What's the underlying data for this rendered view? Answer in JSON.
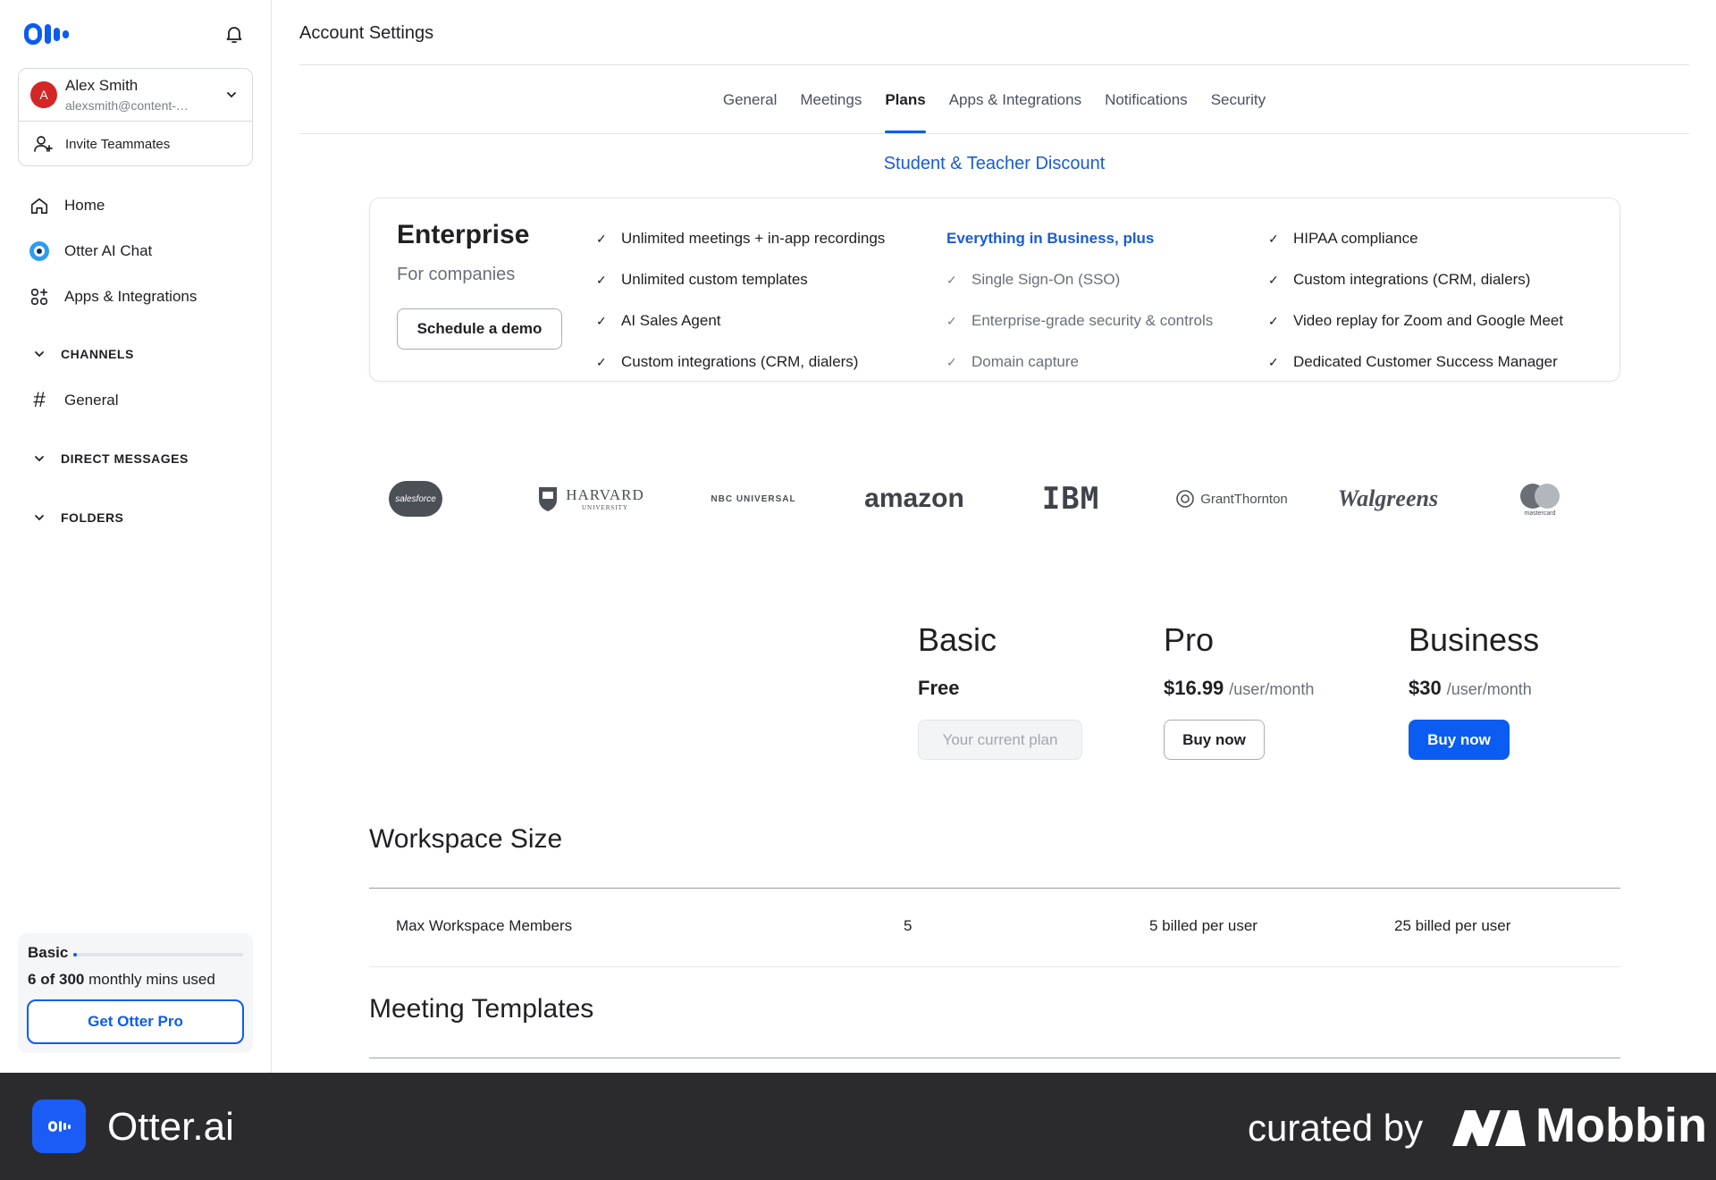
{
  "sidebar": {
    "user": {
      "initial": "A",
      "name": "Alex Smith",
      "email": "alexsmith@content-…"
    },
    "invite_label": "Invite Teammates",
    "nav": [
      {
        "label": "Home",
        "icon": "home-icon"
      },
      {
        "label": "Otter AI Chat",
        "icon": "otter-chat-icon"
      },
      {
        "label": "Apps & Integrations",
        "icon": "apps-icon"
      }
    ],
    "sections": {
      "channels": "CHANNELS",
      "channel_general": "General",
      "direct_messages": "DIRECT MESSAGES",
      "folders": "FOLDERS"
    },
    "usage": {
      "plan": "Basic",
      "used": "6",
      "total": "300",
      "used_fraction": 0.02,
      "suffix": "monthly mins used",
      "of_label": "of",
      "cta": "Get Otter Pro"
    }
  },
  "header": {
    "title": "Account Settings"
  },
  "tabs": [
    {
      "label": "General",
      "active": false
    },
    {
      "label": "Meetings",
      "active": false
    },
    {
      "label": "Plans",
      "active": true
    },
    {
      "label": "Apps & Integrations",
      "active": false
    },
    {
      "label": "Notifications",
      "active": false
    },
    {
      "label": "Security",
      "active": false
    }
  ],
  "discount_link": "Student & Teacher Discount",
  "enterprise": {
    "title": "Enterprise",
    "subtitle": "For companies",
    "cta": "Schedule a demo",
    "col1": [
      "Unlimited meetings + in-app recordings",
      "Unlimited custom templates",
      "AI Sales Agent",
      "Custom integrations (CRM, dialers)"
    ],
    "col2_header": "Everything in Business, plus",
    "col2": [
      "Single Sign-On (SSO)",
      "Enterprise-grade security & controls",
      "Domain capture"
    ],
    "col3": [
      "HIPAA compliance",
      "Custom integrations (CRM, dialers)",
      "Video replay for Zoom and Google Meet",
      "Dedicated Customer Success Manager"
    ]
  },
  "logos": {
    "salesforce": "salesforce",
    "harvard": "HARVARD",
    "harvard_sub": "UNIVERSITY",
    "nbc": "NBC UNIVERSAL",
    "amazon": "amazon",
    "ibm": "IBM",
    "grant_thornton": "GrantThornton",
    "walgreens": "Walgreens",
    "mastercard": "mastercard"
  },
  "plans": [
    {
      "name": "Basic",
      "price": "Free",
      "per": "",
      "button": "Your current plan"
    },
    {
      "name": "Pro",
      "price": "$16.99",
      "per": "/user/month",
      "button": "Buy now"
    },
    {
      "name": "Business",
      "price": "$30",
      "per": "/user/month",
      "button": "Buy now"
    }
  ],
  "workspace": {
    "title": "Workspace Size",
    "row_label": "Max Workspace Members",
    "values": [
      "5",
      "5 billed per user",
      "25 billed per user"
    ]
  },
  "templates": {
    "title": "Meeting Templates"
  },
  "footer": {
    "app_name": "Otter.ai",
    "curated": "curated by",
    "brand": "Mobbin"
  },
  "colors": {
    "accent": "#0b5cf0",
    "link": "#1a5bd6",
    "avatar": "#d32626",
    "footer_bg": "#2b2b2e"
  }
}
